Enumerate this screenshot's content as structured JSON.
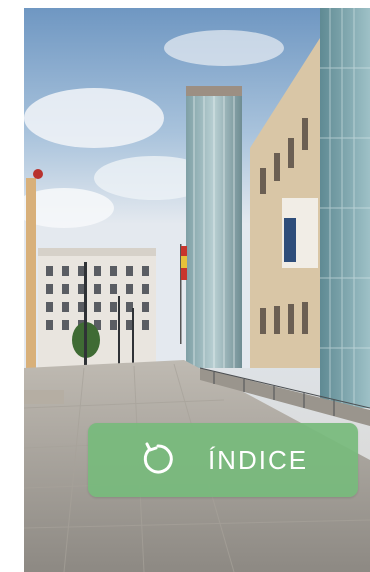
{
  "photo": {
    "description_icon": "museum-exterior-photo"
  },
  "index_button": {
    "label": "ÍNDICE",
    "icon": "refresh-icon",
    "color": "#77ba7c"
  }
}
